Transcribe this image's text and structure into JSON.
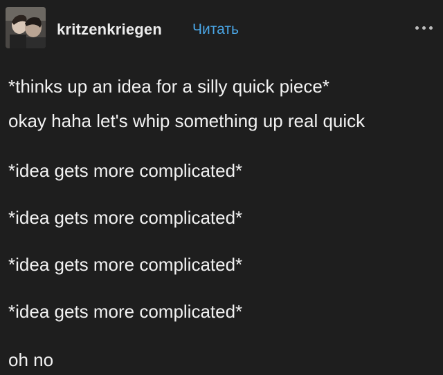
{
  "post": {
    "author": "kritzenkriegen",
    "follow_label": "Читать",
    "more_icon": "ellipsis-icon",
    "avatar_icon": "user-avatar",
    "paragraphs": [
      "*thinks up an idea for a silly quick piece*",
      "okay haha let's whip something up real quick",
      "*idea gets more complicated*",
      "*idea gets more complicated*",
      "*idea gets more complicated*",
      "*idea gets more complicated*",
      "oh no"
    ]
  }
}
